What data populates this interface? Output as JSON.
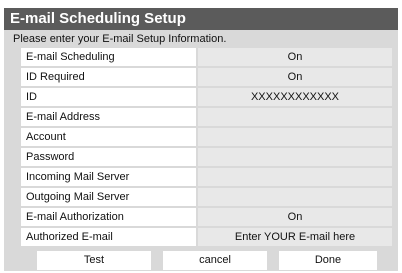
{
  "dialog": {
    "title": "E-mail Scheduling Setup",
    "instructions": "Please enter your E-mail Setup Information."
  },
  "rows": [
    {
      "label": "E-mail Scheduling",
      "value": "On"
    },
    {
      "label": "ID Required",
      "value": "On"
    },
    {
      "label": "ID",
      "value": "XXXXXXXXXXXX"
    },
    {
      "label": "E-mail Address",
      "value": ""
    },
    {
      "label": "Account",
      "value": ""
    },
    {
      "label": "Password",
      "value": ""
    },
    {
      "label": "Incoming Mail Server",
      "value": ""
    },
    {
      "label": "Outgoing Mail Server",
      "value": ""
    },
    {
      "label": "E-mail Authorization",
      "value": "On"
    },
    {
      "label": "Authorized E-mail",
      "value": "Enter YOUR E-mail here"
    }
  ],
  "buttons": {
    "test": "Test",
    "cancel": "cancel",
    "done": "Done"
  },
  "colors": {
    "titlebar": "#5b5b5b",
    "panel": "#d9d9d9",
    "field": "#e8e8e8",
    "label": "#ffffff"
  }
}
